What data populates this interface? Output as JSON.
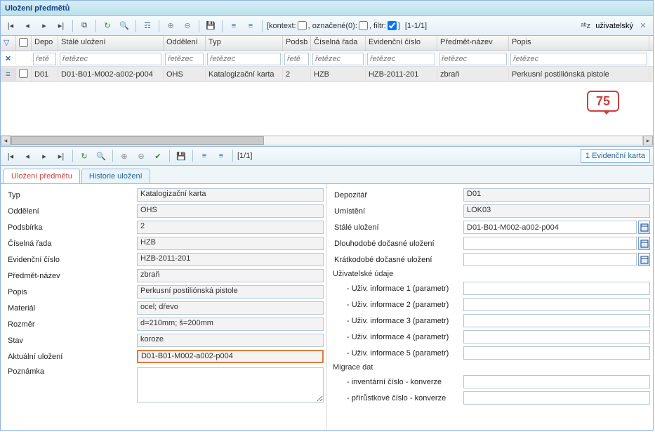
{
  "title": "Uložení předmětů",
  "toolbar": {
    "kontext_label": "[kontext:",
    "oznacene_label": ", označené(0):",
    "filtr_label": ", filtr:",
    "close_bracket": "]",
    "paging": "[1-1/1]",
    "user_label": "uživatelský"
  },
  "columns": {
    "c2": "Depo",
    "c3": "Stálé uložení",
    "c4": "Oddělení",
    "c5": "Typ",
    "c6": "Podsb",
    "c7": "Číselná řada",
    "c8": "Evidenční číslo",
    "c9": "Předmět-název",
    "c10": "Popis"
  },
  "filter_ph": {
    "short": "řetě",
    "full": "řetězec"
  },
  "row": {
    "depo": "D01",
    "stale": "D01-B01-M002-a002-p004",
    "odd": "OHS",
    "typ": "Katalogizační karta",
    "podsb": "2",
    "rada": "HZB",
    "evid": "HZB-2011-201",
    "nazev": "zbraň",
    "popis": "Perkusní postiliónská pistole"
  },
  "callout": "75",
  "toolbar2": {
    "paging": "[1/1]",
    "badge": "1 Evidenční karta"
  },
  "tabs": {
    "t1": "Uložení předmětu",
    "t2": "Historie uložení"
  },
  "left": {
    "typ": {
      "l": "Typ",
      "v": "Katalogizační karta"
    },
    "odd": {
      "l": "Oddělení",
      "v": "OHS"
    },
    "podsb": {
      "l": "Podsbírka",
      "v": "2"
    },
    "rada": {
      "l": "Číselná řada",
      "v": "HZB"
    },
    "evid": {
      "l": "Evidenční číslo",
      "v": "HZB-2011-201"
    },
    "nazev": {
      "l": "Předmět-název",
      "v": "zbraň"
    },
    "popis": {
      "l": "Popis",
      "v": "Perkusní postiliónská pistole"
    },
    "mat": {
      "l": "Materiál",
      "v": "ocel; dřevo"
    },
    "roz": {
      "l": "Rozměr",
      "v": "d=210mm; š=200mm"
    },
    "stav": {
      "l": "Stav",
      "v": "koroze"
    },
    "akt": {
      "l": "Aktuální uložení",
      "v": "D01-B01-M002-a002-p004"
    },
    "pozn": {
      "l": "Poznámka",
      "v": ""
    }
  },
  "right": {
    "depoz": {
      "l": "Depozitář",
      "v": "D01"
    },
    "umist": {
      "l": "Umístění",
      "v": "LOK03"
    },
    "stale": {
      "l": "Stálé uložení",
      "v": "D01-B01-M002-a002-p004"
    },
    "dlouh": {
      "l": "Dlouhodobé dočasné uložení",
      "v": ""
    },
    "krat": {
      "l": "Krátkodobé dočasné uložení",
      "v": ""
    },
    "uziv_section": "Uživatelské údaje",
    "u1": {
      "l": "- Uživ. informace 1 (parametr)",
      "v": ""
    },
    "u2": {
      "l": "- Uživ. informace 2 (parametr)",
      "v": ""
    },
    "u3": {
      "l": "- Uživ. informace 3 (parametr)",
      "v": ""
    },
    "u4": {
      "l": "- Uživ. informace 4 (parametr)",
      "v": ""
    },
    "u5": {
      "l": "- Uživ. informace 5 (parametr)",
      "v": ""
    },
    "migr_section": "Migrace dat",
    "inv": {
      "l": "- inventární číslo - konverze",
      "v": ""
    },
    "prir": {
      "l": "- přírůstkové číslo - konverze",
      "v": ""
    }
  }
}
